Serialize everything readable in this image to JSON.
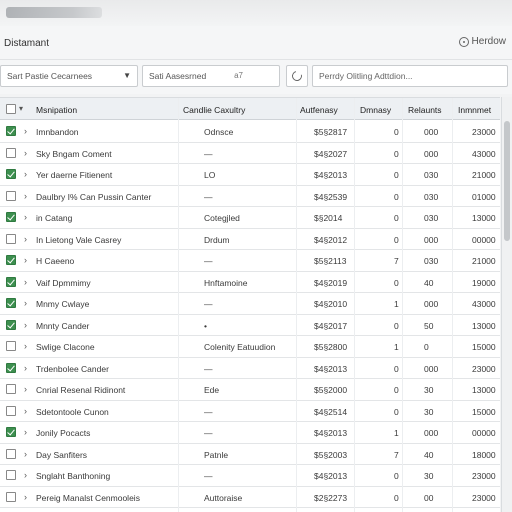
{
  "app": {
    "title": "Distamant",
    "help_label": "Herdow"
  },
  "filters": {
    "filter1": "Sart Pastie Cecarnees",
    "filter2": "Sati Aasesrned",
    "filter2_extra": "a7",
    "search_placeholder": "Perrdy Olitling Adttdion..."
  },
  "columns": [
    "Msnipation",
    "Candlie Caxultry",
    "Autfenasy",
    "Dmnasy",
    "Relaunts",
    "Inmnmet"
  ],
  "rows": [
    {
      "checked": true,
      "name": "Imnbandon",
      "category": "Odnsce",
      "amount": "$5§2817",
      "c1": "0",
      "c2": "000",
      "c3": "23000"
    },
    {
      "checked": false,
      "name": "Sky Bngam Coment",
      "category": "—",
      "amount": "$4§2027",
      "c1": "0",
      "c2": "000",
      "c3": "43000"
    },
    {
      "checked": true,
      "name": "Yer daerne Fitienent",
      "category": "LO",
      "amount": "$4§2013",
      "c1": "0",
      "c2": "030",
      "c3": "21000"
    },
    {
      "checked": false,
      "name": "Daulbry I% Can Pussin Canter",
      "category": "—",
      "amount": "$4§2539",
      "c1": "0",
      "c2": "030",
      "c3": "01000"
    },
    {
      "checked": true,
      "name": "in Catang",
      "category": "Cotegjled",
      "amount": "$§2014",
      "c1": "0",
      "c2": "030",
      "c3": "13000"
    },
    {
      "checked": false,
      "name": "In Lietong Vale Casrey",
      "category": "Drdum",
      "amount": "$4§2012",
      "c1": "0",
      "c2": "000",
      "c3": "00000"
    },
    {
      "checked": true,
      "name": "H Caeeno",
      "category": "—",
      "amount": "$5§2113",
      "c1": "7",
      "c2": "030",
      "c3": "21000"
    },
    {
      "checked": true,
      "name": "Vaif Dpmmimy",
      "category": "Hnftamoine",
      "amount": "$4§2019",
      "c1": "0",
      "c2": "40",
      "c3": "19000"
    },
    {
      "checked": true,
      "name": "Mnmy Cwlaye",
      "category": "—",
      "amount": "$4§2010",
      "c1": "1",
      "c2": "000",
      "c3": "43000"
    },
    {
      "checked": true,
      "name": "Mnnty Cander",
      "category": "•",
      "amount": "$4§2017",
      "c1": "0",
      "c2": "50",
      "c3": "13000"
    },
    {
      "checked": false,
      "name": "Swlige Clacone",
      "category": "Colenity Eatuudion",
      "amount": "$5§2800",
      "c1": "1",
      "c2": "0",
      "c3": "15000"
    },
    {
      "checked": true,
      "name": "Trdenbolee Cander",
      "category": "—",
      "amount": "$4§2013",
      "c1": "0",
      "c2": "000",
      "c3": "23000"
    },
    {
      "checked": false,
      "name": "Cnrial Resenal Ridinont",
      "category": "Ede",
      "amount": "$5§2000",
      "c1": "0",
      "c2": "30",
      "c3": "13000"
    },
    {
      "checked": false,
      "name": "Sdetontoole Cunon",
      "category": "—",
      "amount": "$4§2514",
      "c1": "0",
      "c2": "30",
      "c3": "15000"
    },
    {
      "checked": true,
      "name": "Jonily Pocacts",
      "category": "—",
      "amount": "$4§2013",
      "c1": "1",
      "c2": "000",
      "c3": "00000"
    },
    {
      "checked": false,
      "name": "Day Sanfiters",
      "category": "Patnle",
      "amount": "$5§2003",
      "c1": "7",
      "c2": "40",
      "c3": "18000"
    },
    {
      "checked": false,
      "name": "Snglaht Banthoning",
      "category": "—",
      "amount": "$4§2013",
      "c1": "0",
      "c2": "30",
      "c3": "23000"
    },
    {
      "checked": false,
      "name": "Pereig Manalst Cenmooleis",
      "category": "Auttoraise",
      "amount": "$2§2273",
      "c1": "0",
      "c2": "00",
      "c3": "23000"
    }
  ]
}
